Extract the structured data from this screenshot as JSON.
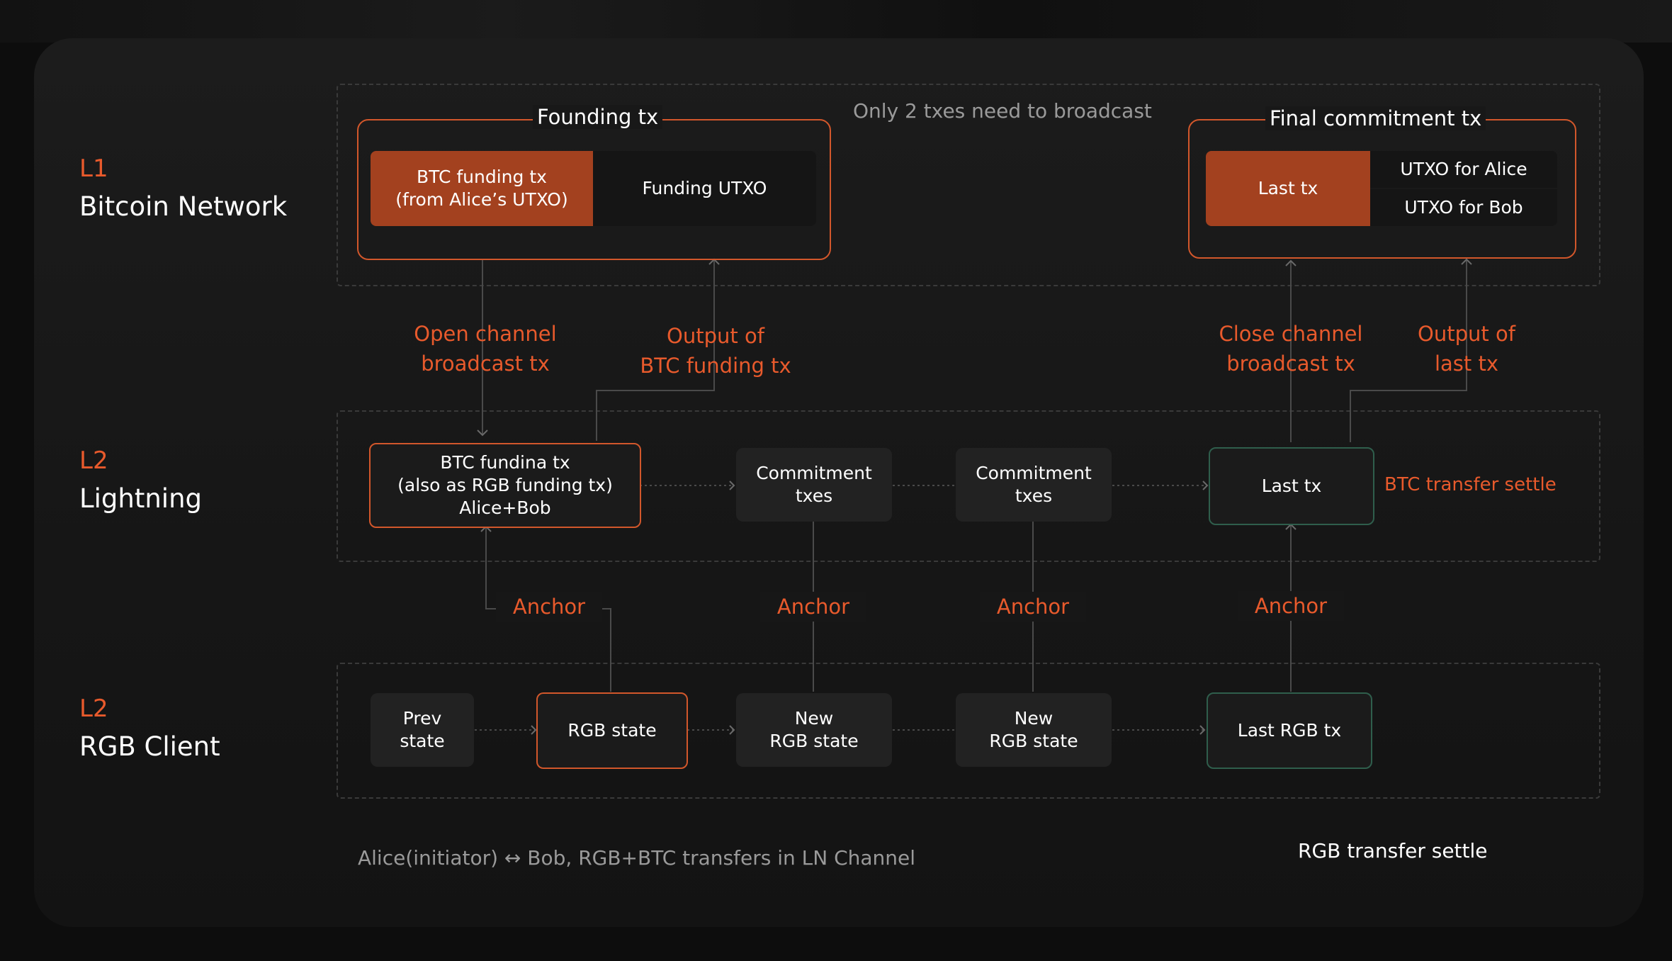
{
  "layers": [
    {
      "tag": "L1",
      "name": "Bitcoin Network"
    },
    {
      "tag": "L2",
      "name": "Lightning"
    },
    {
      "tag": "L2",
      "name": "RGB Client"
    }
  ],
  "l1": {
    "founding": {
      "title": "Founding tx",
      "btc_funding": "BTC funding tx\n(from Alice’s UTXO)",
      "funding_utxo": "Funding UTXO"
    },
    "broadcast_note": "Only 2 txes need to broadcast",
    "final": {
      "title": "Final commitment tx",
      "last_tx": "Last tx",
      "utxo_alice": "UTXO for Alice",
      "utxo_bob": "UTXO for Bob"
    }
  },
  "edge_labels": {
    "open_channel": "Open channel\nbroadcast tx",
    "output_btc_funding": "Output of\nBTC funding tx",
    "close_channel": "Close channel\nbroadcast tx",
    "output_last": "Output of\nlast tx",
    "anchor": "Anchor",
    "btc_settle": "BTC transfer settle"
  },
  "lightning": {
    "funding": "BTC fundina tx\n(also as RGB funding tx)\nAlice+Bob",
    "commitment1": "Commitment\ntxes",
    "commitment2": "Commitment\ntxes",
    "last_tx": "Last tx"
  },
  "rgb": {
    "prev": "Prev\nstate",
    "state": "RGB state",
    "new1": "New\nRGB state",
    "new2": "New\nRGB state",
    "last": "Last RGB tx"
  },
  "footer": {
    "caption": "Alice(initiator) ↔ Bob, RGB+BTC transfers in LN Channel",
    "rgb_settle": "RGB transfer settle"
  },
  "colors": {
    "accent": "#e85a2c",
    "orange_fill": "#a3411f",
    "green_border": "#2f5e4c"
  }
}
